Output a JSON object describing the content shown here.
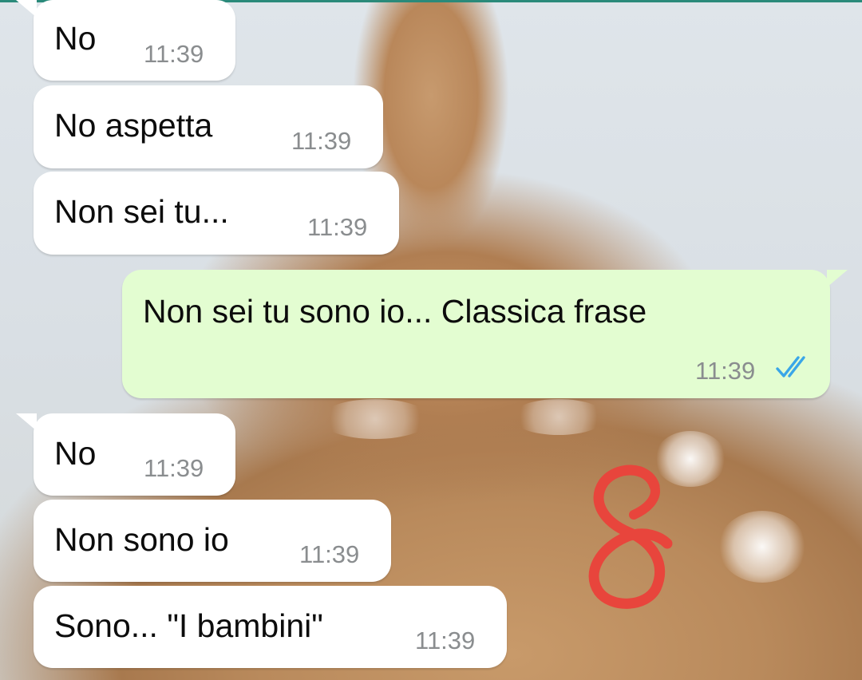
{
  "messages": [
    {
      "text": "No",
      "time": "11:39",
      "direction": "in"
    },
    {
      "text": "No aspetta",
      "time": "11:39",
      "direction": "in"
    },
    {
      "text": "Non sei tu...",
      "time": "11:39",
      "direction": "in"
    },
    {
      "text": "Non sei tu sono io... Classica frase",
      "time": "11:39",
      "direction": "out",
      "status": "read"
    },
    {
      "text": "No",
      "time": "11:39",
      "direction": "in"
    },
    {
      "text": "Non sono io",
      "time": "11:39",
      "direction": "in"
    },
    {
      "text": "Sono... \"I bambini\"",
      "time": "11:39",
      "direction": "in"
    }
  ],
  "icons": {
    "read_receipt": "double-check-icon",
    "annotation": "handwritten-8-icon"
  },
  "colors": {
    "incoming_bubble": "#ffffff",
    "outgoing_bubble": "#e3fdd1",
    "read_ticks": "#3aa6e8",
    "annotation_stroke": "#e8453c",
    "time_text": "#8a8d8f"
  }
}
